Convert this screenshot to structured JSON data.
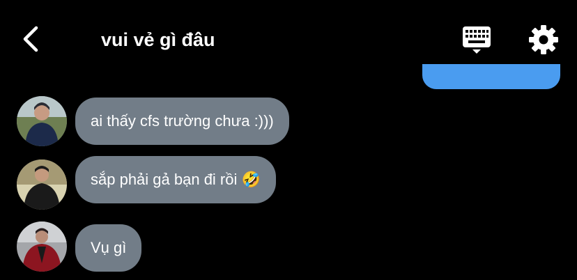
{
  "header": {
    "title": "vui vẻ gì đâu",
    "back_icon": "chevron-left-icon",
    "keyboard_icon": "keyboard-icon",
    "settings_icon": "gear-icon"
  },
  "colors": {
    "background": "#000000",
    "received_bubble": "#727d88",
    "sent_bubble": "#4a9cf0",
    "text": "#ffffff"
  },
  "messages": [
    {
      "text": "ai thấy cfs trường chưa :)))"
    },
    {
      "text": "sắp phải gả bạn đi rồi 🤣"
    },
    {
      "text": "Vụ gì"
    }
  ]
}
